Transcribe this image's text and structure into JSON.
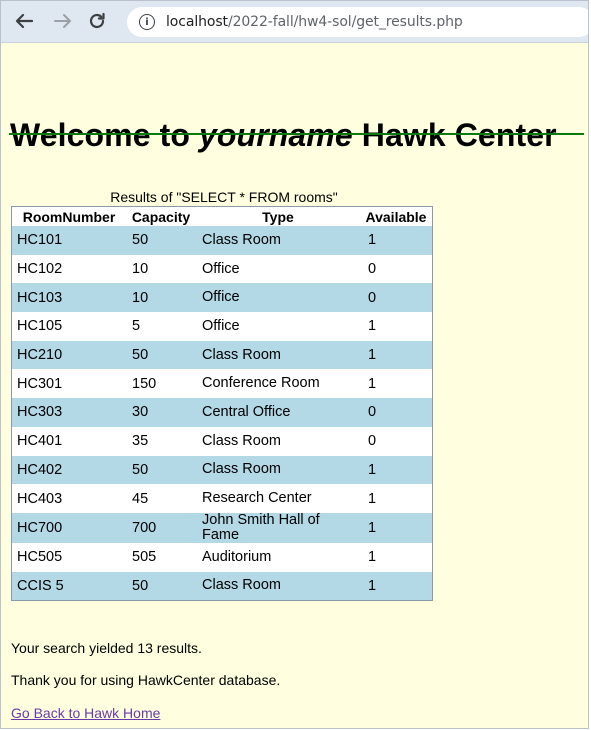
{
  "browser": {
    "url_host": "localhost",
    "url_path": "/2022-fall/hw4-sol/get_results.php",
    "info_symbol": "i"
  },
  "heading": {
    "prefix": "Welcome to ",
    "name": "yourname",
    "suffix": " Hawk Center"
  },
  "table": {
    "caption": "Results of \"SELECT * FROM rooms\"",
    "headers": [
      "RoomNumber",
      "Capacity",
      "Type",
      "Available"
    ],
    "rows": [
      [
        "HC101",
        "50",
        "Class Room",
        "1"
      ],
      [
        "HC102",
        "10",
        "Office",
        "0"
      ],
      [
        "HC103",
        "10",
        "Office",
        "0"
      ],
      [
        "HC105",
        "5",
        "Office",
        "1"
      ],
      [
        "HC210",
        "50",
        "Class Room",
        "1"
      ],
      [
        "HC301",
        "150",
        "Conference Room",
        "1"
      ],
      [
        "HC303",
        "30",
        "Central Office",
        "0"
      ],
      [
        "HC401",
        "35",
        "Class Room",
        "0"
      ],
      [
        "HC402",
        "50",
        "Class Room",
        "1"
      ],
      [
        "HC403",
        "45",
        "Research Center",
        "1"
      ],
      [
        "HC700",
        "700",
        "John Smith Hall of Fame",
        "1"
      ],
      [
        "HC505",
        "505",
        "Auditorium",
        "1"
      ],
      [
        "CCIS 5",
        "50",
        "Class Room",
        "1"
      ]
    ]
  },
  "summary": "Your search yielded 13 results.",
  "thanks": "Thank you for using HawkCenter database.",
  "back_link": "Go Back to Hawk Home",
  "colors": {
    "page_background": "#ffffe0",
    "row_highlight": "#b3d8e6",
    "rule": "#0e7a0e",
    "visited_link": "#6b3aa8"
  }
}
